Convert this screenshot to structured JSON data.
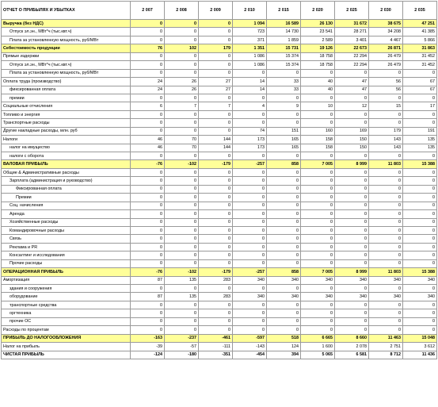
{
  "header": {
    "title": "ОТЧЕТ О ПРИБЫЛЯХ И УБЫТКАХ",
    "years": [
      "2 007",
      "2 008",
      "2 009",
      "2 010",
      "2 015",
      "2 020",
      "2 025",
      "2 030",
      "2 035"
    ]
  },
  "rows": [
    {
      "label": "Выручка (без НДС)",
      "style": "hl",
      "indent": 0,
      "values": [
        "0",
        "0",
        "0",
        "1 094",
        "16 589",
        "26 130",
        "31 672",
        "38 675",
        "47 251"
      ]
    },
    {
      "label": "Отпуск эл.эн., МВт*ч (тыс.квт.ч)",
      "style": "",
      "indent": 1,
      "values": [
        "0",
        "0",
        "0",
        "723",
        "14 730",
        "23 541",
        "28 271",
        "34 208",
        "41 385"
      ]
    },
    {
      "label": "Плата за установленную мощность, руб/МВт",
      "style": "",
      "indent": 1,
      "values": [
        "0",
        "0",
        "0",
        "371",
        "1 859",
        "2 589",
        "3 401",
        "4 467",
        "5 866"
      ]
    },
    {
      "label": "Себестоимость продукции",
      "style": "hl",
      "indent": 0,
      "values": [
        "76",
        "102",
        "179",
        "1 351",
        "15 731",
        "19 126",
        "22 673",
        "26 871",
        "31 863"
      ]
    },
    {
      "label": "Прямые издержки",
      "style": "",
      "indent": 0,
      "values": [
        "0",
        "0",
        "0",
        "1 086",
        "15 374",
        "18 758",
        "22 294",
        "26 479",
        "31 452"
      ]
    },
    {
      "label": "Отпуск эл.эн., МВт*ч (тыс.квт.ч)",
      "style": "",
      "indent": 1,
      "values": [
        "0",
        "0",
        "0",
        "1 086",
        "15 374",
        "18 758",
        "22 294",
        "26 479",
        "31 452"
      ]
    },
    {
      "label": "Плата за установленную мощность, руб/МВт",
      "style": "",
      "indent": 1,
      "values": [
        "0",
        "0",
        "0",
        "0",
        "0",
        "0",
        "0",
        "0",
        "0"
      ]
    },
    {
      "label": "Оплата труда (производство)",
      "style": "",
      "indent": 0,
      "values": [
        "24",
        "26",
        "27",
        "14",
        "33",
        "40",
        "47",
        "56",
        "67"
      ]
    },
    {
      "label": "фиксированная оплата",
      "style": "",
      "indent": 1,
      "values": [
        "24",
        "26",
        "27",
        "14",
        "33",
        "40",
        "47",
        "56",
        "67"
      ]
    },
    {
      "label": "премии",
      "style": "",
      "indent": 1,
      "values": [
        "0",
        "0",
        "0",
        "0",
        "0",
        "0",
        "0",
        "0",
        "0"
      ]
    },
    {
      "label": "Социальные отчисления",
      "style": "",
      "indent": 0,
      "values": [
        "6",
        "7",
        "7",
        "4",
        "9",
        "10",
        "12",
        "15",
        "17"
      ]
    },
    {
      "label": "Топливо и энергия",
      "style": "",
      "indent": 0,
      "values": [
        "0",
        "0",
        "0",
        "0",
        "0",
        "0",
        "0",
        "0",
        "0"
      ]
    },
    {
      "label": "Транспортные расходы",
      "style": "",
      "indent": 0,
      "values": [
        "0",
        "0",
        "0",
        "0",
        "0",
        "0",
        "0",
        "0",
        "0"
      ]
    },
    {
      "label": "Другие накладные расходы, млн. руб",
      "style": "",
      "indent": 0,
      "values": [
        "0",
        "0",
        "0",
        "74",
        "151",
        "160",
        "169",
        "179",
        "191"
      ]
    },
    {
      "label": "Налоги",
      "style": "",
      "indent": 0,
      "values": [
        "46",
        "70",
        "144",
        "173",
        "165",
        "158",
        "150",
        "143",
        "135"
      ]
    },
    {
      "label": "налог на имущество",
      "style": "",
      "indent": 1,
      "values": [
        "46",
        "70",
        "144",
        "173",
        "165",
        "158",
        "150",
        "143",
        "135"
      ]
    },
    {
      "label": "налоги с оборота",
      "style": "",
      "indent": 1,
      "values": [
        "0",
        "0",
        "0",
        "0",
        "0",
        "0",
        "0",
        "0",
        "0"
      ]
    },
    {
      "label": "ВАЛОВАЯ ПРИБЫЛЬ",
      "style": "hl",
      "indent": 0,
      "values": [
        "-76",
        "-102",
        "-179",
        "-257",
        "858",
        "7 005",
        "8 999",
        "11 803",
        "15 388"
      ]
    },
    {
      "label": "Общие & Административные расходы",
      "style": "",
      "indent": 0,
      "values": [
        "0",
        "0",
        "0",
        "0",
        "0",
        "0",
        "0",
        "0",
        "0"
      ]
    },
    {
      "label": "Зарплата (администрация и руководство)",
      "style": "",
      "indent": 1,
      "values": [
        "0",
        "0",
        "0",
        "0",
        "0",
        "0",
        "0",
        "0",
        "0"
      ]
    },
    {
      "label": "Фиксированная оплата",
      "style": "",
      "indent": 2,
      "values": [
        "0",
        "0",
        "0",
        "0",
        "0",
        "0",
        "0",
        "0",
        "0"
      ]
    },
    {
      "label": "Премии",
      "style": "",
      "indent": 2,
      "values": [
        "0",
        "0",
        "0",
        "0",
        "0",
        "0",
        "0",
        "0",
        "0"
      ]
    },
    {
      "label": "Соц. начисления",
      "style": "",
      "indent": 1,
      "values": [
        "0",
        "0",
        "0",
        "0",
        "0",
        "0",
        "0",
        "0",
        "0"
      ]
    },
    {
      "label": "Аренда",
      "style": "",
      "indent": 1,
      "values": [
        "0",
        "0",
        "0",
        "0",
        "0",
        "0",
        "0",
        "0",
        "0"
      ]
    },
    {
      "label": "Хозяйственные расходы",
      "style": "",
      "indent": 1,
      "values": [
        "0",
        "0",
        "0",
        "0",
        "0",
        "0",
        "0",
        "0",
        "0"
      ]
    },
    {
      "label": "Командировочные расходы",
      "style": "",
      "indent": 1,
      "values": [
        "0",
        "0",
        "0",
        "0",
        "0",
        "0",
        "0",
        "0",
        "0"
      ]
    },
    {
      "label": "Связь",
      "style": "",
      "indent": 1,
      "values": [
        "0",
        "0",
        "0",
        "0",
        "0",
        "0",
        "0",
        "0",
        "0"
      ]
    },
    {
      "label": "Реклама и PR",
      "style": "",
      "indent": 1,
      "values": [
        "0",
        "0",
        "0",
        "0",
        "0",
        "0",
        "0",
        "0",
        "0"
      ]
    },
    {
      "label": "Консалтинг и исследования",
      "style": "",
      "indent": 1,
      "values": [
        "0",
        "0",
        "0",
        "0",
        "0",
        "0",
        "0",
        "0",
        "0"
      ]
    },
    {
      "label": "Прочие расходы",
      "style": "",
      "indent": 1,
      "values": [
        "0",
        "0",
        "0",
        "0",
        "0",
        "0",
        "0",
        "0",
        "0"
      ]
    },
    {
      "label": "ОПЕРАЦИОННАЯ ПРИБЫЛЬ",
      "style": "hl",
      "indent": 0,
      "values": [
        "-76",
        "-102",
        "-179",
        "-257",
        "858",
        "7 005",
        "8 999",
        "11 803",
        "15 388"
      ]
    },
    {
      "label": "Амортизация",
      "style": "",
      "indent": 0,
      "values": [
        "87",
        "135",
        "283",
        "340",
        "340",
        "340",
        "340",
        "340",
        "340"
      ]
    },
    {
      "label": "здания и сооружения",
      "style": "",
      "indent": 1,
      "values": [
        "0",
        "0",
        "0",
        "0",
        "0",
        "0",
        "0",
        "0",
        "0"
      ]
    },
    {
      "label": "оборудование",
      "style": "",
      "indent": 1,
      "values": [
        "87",
        "135",
        "283",
        "340",
        "340",
        "340",
        "340",
        "340",
        "340"
      ]
    },
    {
      "label": "транспортные средства",
      "style": "",
      "indent": 1,
      "values": [
        "0",
        "0",
        "0",
        "0",
        "0",
        "0",
        "0",
        "0",
        "0"
      ]
    },
    {
      "label": "оргтехника",
      "style": "",
      "indent": 1,
      "values": [
        "0",
        "0",
        "0",
        "0",
        "0",
        "0",
        "0",
        "0",
        "0"
      ]
    },
    {
      "label": "прочие ОС",
      "style": "",
      "indent": 1,
      "values": [
        "0",
        "0",
        "0",
        "0",
        "0",
        "0",
        "0",
        "0",
        "0"
      ]
    },
    {
      "label": "Расходы по процентам",
      "style": "",
      "indent": 0,
      "values": [
        "0",
        "0",
        "0",
        "0",
        "0",
        "0",
        "0",
        "0",
        "0"
      ]
    },
    {
      "label": "ПРИБЫЛЬ ДО НАЛОГООБЛОЖЕНИЯ",
      "style": "hl",
      "indent": 0,
      "values": [
        "-163",
        "-237",
        "-461",
        "-597",
        "518",
        "6 665",
        "8 660",
        "11 463",
        "15 048"
      ]
    },
    {
      "label": "Налог на прибыль",
      "style": "",
      "indent": 0,
      "values": [
        "-39",
        "-57",
        "-111",
        "-143",
        "124",
        "1 600",
        "2 078",
        "2 751",
        "3 612"
      ]
    },
    {
      "label": "ЧИСТАЯ ПРИБЫЛЬ",
      "style": "bold",
      "indent": 0,
      "values": [
        "-124",
        "-180",
        "-351",
        "-454",
        "394",
        "5 065",
        "6 581",
        "8 712",
        "11 436"
      ]
    }
  ]
}
